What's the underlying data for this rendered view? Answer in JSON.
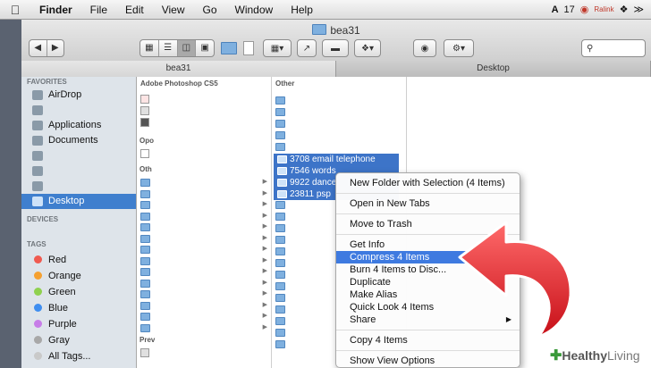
{
  "menubar": {
    "apple_icon": "apple-logo",
    "items": [
      "Finder",
      "File",
      "Edit",
      "View",
      "Go",
      "Window",
      "Help"
    ],
    "status": {
      "app_badge": "17",
      "ralink_label": "Ralink"
    }
  },
  "window": {
    "title": "bea31",
    "tabs": [
      "bea31",
      "Desktop"
    ]
  },
  "sidebar": {
    "favorites_header": "FAVORITES",
    "favorites": [
      {
        "label": "AirDrop",
        "icon": "airdrop-icon"
      },
      {
        "label": "",
        "icon": "home-icon"
      },
      {
        "label": "Applications",
        "icon": "applications-icon"
      },
      {
        "label": "Documents",
        "icon": "documents-icon"
      },
      {
        "label": "",
        "icon": "drive-icon"
      },
      {
        "label": "",
        "icon": "folder-icon"
      },
      {
        "label": "",
        "icon": "folder-icon"
      },
      {
        "label": "Desktop",
        "icon": "desktop-icon",
        "selected": true
      }
    ],
    "devices_header": "DEVICES",
    "tags_header": "TAGS",
    "tags": [
      {
        "label": "Red",
        "color": "#f05a50"
      },
      {
        "label": "Orange",
        "color": "#f5a030"
      },
      {
        "label": "Green",
        "color": "#8fd14f"
      },
      {
        "label": "Blue",
        "color": "#3f8ef0"
      },
      {
        "label": "Purple",
        "color": "#c77de8"
      },
      {
        "label": "Gray",
        "color": "#a8a8a8"
      },
      {
        "label": "All Tags...",
        "color": "#c9c9c9"
      }
    ]
  },
  "columns": {
    "col1_header": "Adobe Photoshop CS5",
    "col1_sec1": "Opo",
    "col1_sec2": "Oth",
    "col1_sec3": "Prev",
    "col2_header": "Other"
  },
  "selected_items": [
    "3708 email telephone",
    "7546 words",
    "9922 dance",
    "23811 psp"
  ],
  "context_menu": {
    "items": [
      "New Folder with Selection (4 Items)",
      "Open in New Tabs",
      "Move to Trash",
      "Get Info",
      "Compress 4 Items",
      "Burn 4 Items to Disc...",
      "Duplicate",
      "Make Alias",
      "Quick Look 4 Items",
      "Share",
      "Copy 4 Items",
      "Show View Options"
    ],
    "highlighted": "Compress 4 Items"
  },
  "colors": {
    "selection": "#3d74c8",
    "highlight": "#3e7ae0",
    "arrow": "#e8202a"
  },
  "branding": {
    "logo_a": "Healthy",
    "logo_b": "Living"
  }
}
